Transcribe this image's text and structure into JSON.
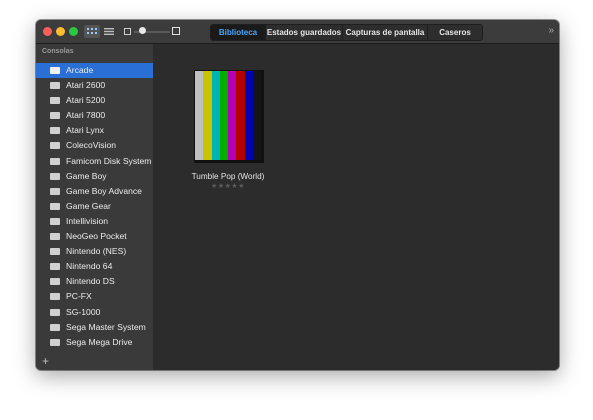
{
  "toolbar": {
    "icons": [
      "close",
      "minimize",
      "zoom",
      "grid-view-icon",
      "list-view-icon",
      "small-size-icon",
      "large-size-icon"
    ],
    "size_slider_value": 0.15
  },
  "tabs": [
    {
      "label": "Biblioteca",
      "active": true
    },
    {
      "label": "Estados guardados",
      "active": false
    },
    {
      "label": "Capturas de pantalla",
      "active": false
    },
    {
      "label": "Caseros",
      "active": false
    }
  ],
  "overflow_glyph": "»",
  "sidebar": {
    "header": "Consolas",
    "items": [
      {
        "label": "Arcade",
        "selected": true
      },
      {
        "label": "Atari 2600",
        "selected": false
      },
      {
        "label": "Atari 5200",
        "selected": false
      },
      {
        "label": "Atari 7800",
        "selected": false
      },
      {
        "label": "Atari Lynx",
        "selected": false
      },
      {
        "label": "ColecoVision",
        "selected": false
      },
      {
        "label": "Famicom Disk System",
        "selected": false
      },
      {
        "label": "Game Boy",
        "selected": false
      },
      {
        "label": "Game Boy Advance",
        "selected": false
      },
      {
        "label": "Game Gear",
        "selected": false
      },
      {
        "label": "Intellivision",
        "selected": false
      },
      {
        "label": "NeoGeo Pocket",
        "selected": false
      },
      {
        "label": "Nintendo (NES)",
        "selected": false
      },
      {
        "label": "Nintendo 64",
        "selected": false
      },
      {
        "label": "Nintendo DS",
        "selected": false
      },
      {
        "label": "PC-FX",
        "selected": false
      },
      {
        "label": "SG-1000",
        "selected": false
      },
      {
        "label": "Sega Master System",
        "selected": false
      },
      {
        "label": "Sega Mega Drive",
        "selected": false
      }
    ],
    "add_glyph": "+"
  },
  "library": {
    "games": [
      {
        "title": "Tumble Pop (World)",
        "rating_glyphs": "★★★★★",
        "rating": 0
      }
    ]
  },
  "colors": {
    "accent": "#4aa6ff",
    "selection": "#2a6fd6",
    "color_bars": [
      "#c0c0c0",
      "#c8c400",
      "#00b4b4",
      "#00b000",
      "#b400b4",
      "#b40000",
      "#0000b4",
      "#151515"
    ]
  }
}
